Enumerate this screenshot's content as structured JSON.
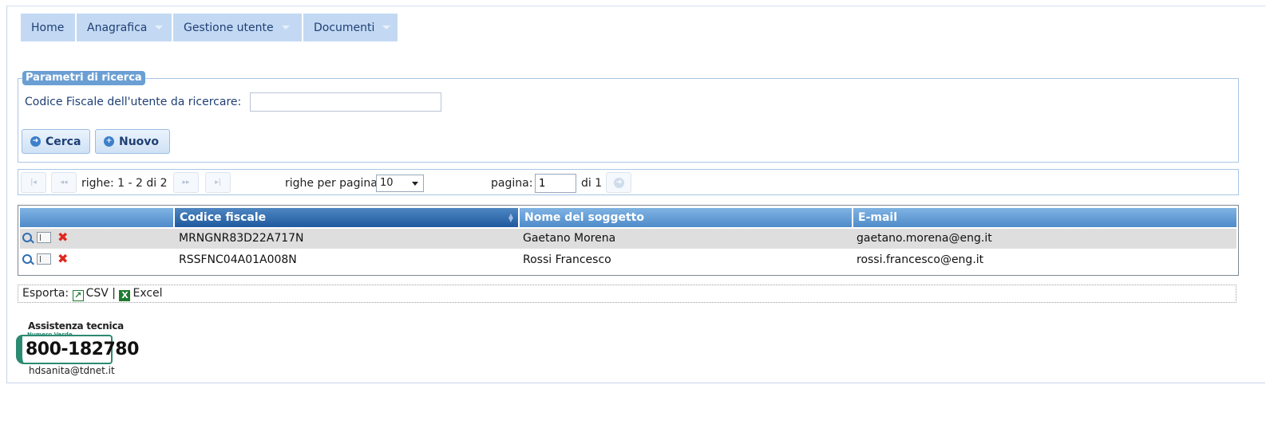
{
  "menu": {
    "items": [
      {
        "label": "Home"
      },
      {
        "label": "Anagrafica"
      },
      {
        "label": "Gestione utente"
      },
      {
        "label": "Documenti"
      }
    ]
  },
  "search": {
    "legend": "Parametri di ricerca",
    "label": "Codice Fiscale dell'utente da ricercare:",
    "value": "",
    "search_button": "Cerca",
    "new_button": "Nuovo"
  },
  "pager": {
    "rows_info": "righe: 1 - 2 di 2",
    "rows_per_page_label": "righe per pagina",
    "rows_per_page_value": "10",
    "page_label": "pagina:",
    "page_value": "1",
    "page_total": "di 1"
  },
  "table": {
    "columns": [
      "",
      "Codice fiscale",
      "Nome del soggetto",
      "E-mail"
    ],
    "rows": [
      {
        "codice_fiscale": "MRNGNR83D22A717N",
        "nome": "Gaetano Morena",
        "email": "gaetano.morena@eng.it"
      },
      {
        "codice_fiscale": "RSSFNC04A01A008N",
        "nome": "Rossi Francesco",
        "email": "rossi.francesco@eng.it"
      }
    ]
  },
  "export": {
    "label": "Esporta:",
    "csv": "CSV",
    "separator": "|",
    "excel": "Excel"
  },
  "support": {
    "title": "Assistenza tecnica",
    "subtitle": "Numero Verde",
    "phone": "800-182780",
    "email": "hdsanita@tdnet.it"
  }
}
